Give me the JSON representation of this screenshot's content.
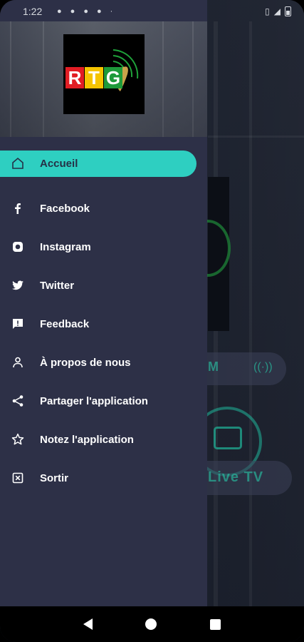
{
  "status_bar": {
    "time": "1:22"
  },
  "logo": {
    "letters": [
      "R",
      "T",
      "G"
    ],
    "letter_colors": [
      "#e21d24",
      "#f5c400",
      "#1e9a3a"
    ]
  },
  "background": {
    "radio_label": "M",
    "live_tv_label": "Live TV"
  },
  "menu": {
    "active_color": "#2ecfc1",
    "items": [
      {
        "label": "Accueil",
        "icon": "home-icon"
      },
      {
        "label": "Facebook",
        "icon": "facebook-icon"
      },
      {
        "label": "Instagram",
        "icon": "instagram-icon"
      },
      {
        "label": "Twitter",
        "icon": "twitter-icon"
      },
      {
        "label": "Feedback",
        "icon": "feedback-icon"
      },
      {
        "label": "À propos de nous",
        "icon": "person-icon"
      },
      {
        "label": "Partager l'application",
        "icon": "share-icon"
      },
      {
        "label": "Notez l'application",
        "icon": "star-icon"
      },
      {
        "label": "Sortir",
        "icon": "exit-icon"
      }
    ]
  }
}
